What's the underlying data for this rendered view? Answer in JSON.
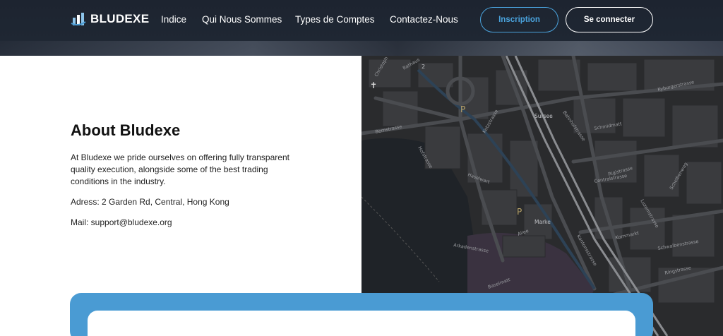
{
  "brand": {
    "name": "BLUDEXE",
    "logo_icon": "building-chart-icon"
  },
  "nav": {
    "items": [
      "Indice",
      "Qui Nous Sommes",
      "Types de Comptes",
      "Contactez-Nous"
    ]
  },
  "auth": {
    "signup_label": "Inscription",
    "login_label": "Se connecter"
  },
  "about": {
    "title": "About Bludexe",
    "description": "At Bludexe we pride ourselves on offering fully transparent quality execution, alongside some of the best trading conditions in the industry.",
    "address": "Adress: 2 Garden Rd, Central, Hong Kong",
    "mail": "Mail: support@bludexe.org"
  },
  "map": {
    "labels": [
      "Bernstrasse",
      "Sursee",
      "Centralstrasse",
      "Bahnhofstrasse",
      "Rigistrasse",
      "Haselwart",
      "Kornmarkt",
      "Marke",
      "Allee",
      "Kantonsstrasse",
      "Schwalbenstrasse",
      "Schmidmatt",
      "Luzernstrasse",
      "Kyburgerstrasse",
      "Christoph",
      "Hofstrasse",
      "Rathaus",
      "Ringstrasse",
      "Baselmatt",
      "Arkadenstrasse",
      "Kotzstrasse",
      "Schelbenwag",
      "2"
    ],
    "colors": {
      "background": "#2a2b2d",
      "block": "#3a3b3e",
      "road": "#4a4c50",
      "rail": "#8a8c90",
      "water": "#1e2a36",
      "park": "#3d3340"
    }
  },
  "colors": {
    "accent": "#4a9bd3",
    "header_bg": "#1d2430"
  }
}
